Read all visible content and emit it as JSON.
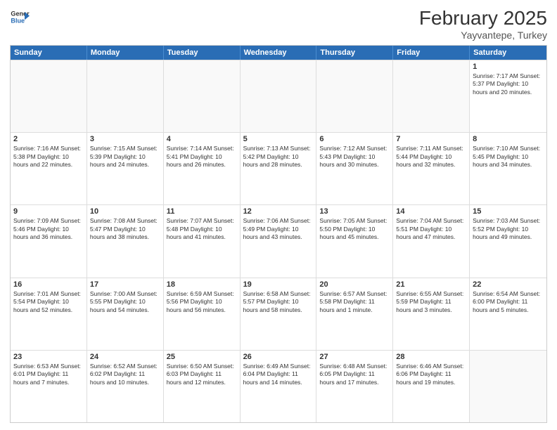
{
  "logo": {
    "line1": "General",
    "line2": "Blue"
  },
  "title": {
    "month_year": "February 2025",
    "location": "Yayvantepe, Turkey"
  },
  "header_days": [
    "Sunday",
    "Monday",
    "Tuesday",
    "Wednesday",
    "Thursday",
    "Friday",
    "Saturday"
  ],
  "rows": [
    [
      {
        "day": "",
        "info": ""
      },
      {
        "day": "",
        "info": ""
      },
      {
        "day": "",
        "info": ""
      },
      {
        "day": "",
        "info": ""
      },
      {
        "day": "",
        "info": ""
      },
      {
        "day": "",
        "info": ""
      },
      {
        "day": "1",
        "info": "Sunrise: 7:17 AM\nSunset: 5:37 PM\nDaylight: 10 hours\nand 20 minutes."
      }
    ],
    [
      {
        "day": "2",
        "info": "Sunrise: 7:16 AM\nSunset: 5:38 PM\nDaylight: 10 hours\nand 22 minutes."
      },
      {
        "day": "3",
        "info": "Sunrise: 7:15 AM\nSunset: 5:39 PM\nDaylight: 10 hours\nand 24 minutes."
      },
      {
        "day": "4",
        "info": "Sunrise: 7:14 AM\nSunset: 5:41 PM\nDaylight: 10 hours\nand 26 minutes."
      },
      {
        "day": "5",
        "info": "Sunrise: 7:13 AM\nSunset: 5:42 PM\nDaylight: 10 hours\nand 28 minutes."
      },
      {
        "day": "6",
        "info": "Sunrise: 7:12 AM\nSunset: 5:43 PM\nDaylight: 10 hours\nand 30 minutes."
      },
      {
        "day": "7",
        "info": "Sunrise: 7:11 AM\nSunset: 5:44 PM\nDaylight: 10 hours\nand 32 minutes."
      },
      {
        "day": "8",
        "info": "Sunrise: 7:10 AM\nSunset: 5:45 PM\nDaylight: 10 hours\nand 34 minutes."
      }
    ],
    [
      {
        "day": "9",
        "info": "Sunrise: 7:09 AM\nSunset: 5:46 PM\nDaylight: 10 hours\nand 36 minutes."
      },
      {
        "day": "10",
        "info": "Sunrise: 7:08 AM\nSunset: 5:47 PM\nDaylight: 10 hours\nand 38 minutes."
      },
      {
        "day": "11",
        "info": "Sunrise: 7:07 AM\nSunset: 5:48 PM\nDaylight: 10 hours\nand 41 minutes."
      },
      {
        "day": "12",
        "info": "Sunrise: 7:06 AM\nSunset: 5:49 PM\nDaylight: 10 hours\nand 43 minutes."
      },
      {
        "day": "13",
        "info": "Sunrise: 7:05 AM\nSunset: 5:50 PM\nDaylight: 10 hours\nand 45 minutes."
      },
      {
        "day": "14",
        "info": "Sunrise: 7:04 AM\nSunset: 5:51 PM\nDaylight: 10 hours\nand 47 minutes."
      },
      {
        "day": "15",
        "info": "Sunrise: 7:03 AM\nSunset: 5:52 PM\nDaylight: 10 hours\nand 49 minutes."
      }
    ],
    [
      {
        "day": "16",
        "info": "Sunrise: 7:01 AM\nSunset: 5:54 PM\nDaylight: 10 hours\nand 52 minutes."
      },
      {
        "day": "17",
        "info": "Sunrise: 7:00 AM\nSunset: 5:55 PM\nDaylight: 10 hours\nand 54 minutes."
      },
      {
        "day": "18",
        "info": "Sunrise: 6:59 AM\nSunset: 5:56 PM\nDaylight: 10 hours\nand 56 minutes."
      },
      {
        "day": "19",
        "info": "Sunrise: 6:58 AM\nSunset: 5:57 PM\nDaylight: 10 hours\nand 58 minutes."
      },
      {
        "day": "20",
        "info": "Sunrise: 6:57 AM\nSunset: 5:58 PM\nDaylight: 11 hours\nand 1 minute."
      },
      {
        "day": "21",
        "info": "Sunrise: 6:55 AM\nSunset: 5:59 PM\nDaylight: 11 hours\nand 3 minutes."
      },
      {
        "day": "22",
        "info": "Sunrise: 6:54 AM\nSunset: 6:00 PM\nDaylight: 11 hours\nand 5 minutes."
      }
    ],
    [
      {
        "day": "23",
        "info": "Sunrise: 6:53 AM\nSunset: 6:01 PM\nDaylight: 11 hours\nand 7 minutes."
      },
      {
        "day": "24",
        "info": "Sunrise: 6:52 AM\nSunset: 6:02 PM\nDaylight: 11 hours\nand 10 minutes."
      },
      {
        "day": "25",
        "info": "Sunrise: 6:50 AM\nSunset: 6:03 PM\nDaylight: 11 hours\nand 12 minutes."
      },
      {
        "day": "26",
        "info": "Sunrise: 6:49 AM\nSunset: 6:04 PM\nDaylight: 11 hours\nand 14 minutes."
      },
      {
        "day": "27",
        "info": "Sunrise: 6:48 AM\nSunset: 6:05 PM\nDaylight: 11 hours\nand 17 minutes."
      },
      {
        "day": "28",
        "info": "Sunrise: 6:46 AM\nSunset: 6:06 PM\nDaylight: 11 hours\nand 19 minutes."
      },
      {
        "day": "",
        "info": ""
      }
    ]
  ]
}
